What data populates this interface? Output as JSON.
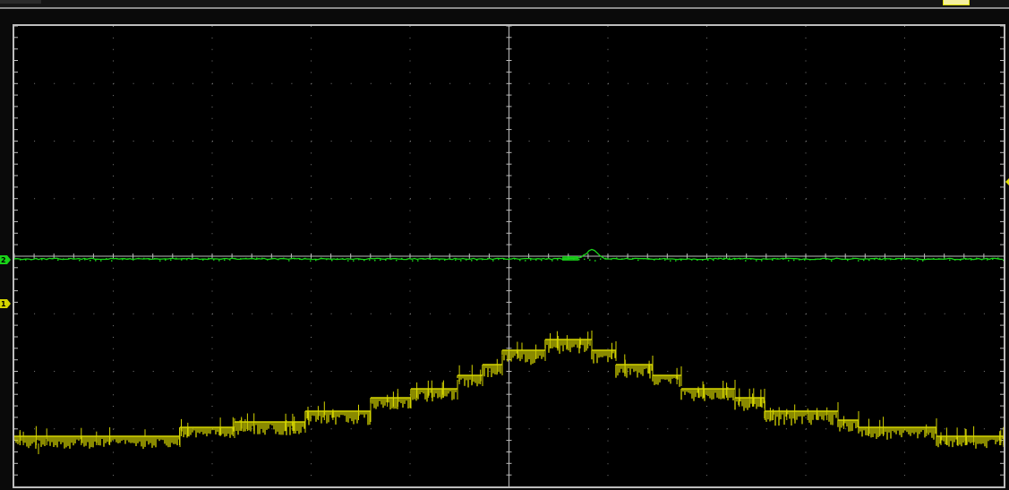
{
  "scope": {
    "divisions": {
      "horizontal": 10,
      "vertical": 8
    },
    "channels": [
      {
        "id": "ch1",
        "label": "1",
        "color": "#d4d400"
      },
      {
        "id": "ch2",
        "label": "2",
        "color": "#19d419"
      }
    ],
    "trigger_marker": {
      "color": "#e0e000"
    }
  }
}
